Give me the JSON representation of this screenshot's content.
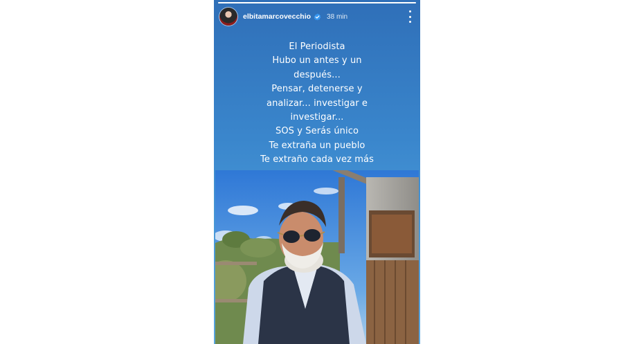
{
  "story": {
    "progress": 1.0,
    "username": "elbitamarcovecchio",
    "verified": true,
    "timestamp": "38 min",
    "caption_lines": [
      "El Periodista",
      "Hubo un antes y un",
      "después...",
      "Pensar, detenerse y",
      "analizar... investigar e",
      "investigar...",
      "SOS y Serás único",
      "Te extraña un pueblo",
      "Te extraño cada vez más"
    ],
    "icons": {
      "avatar": "profile-avatar",
      "verified": "verified-badge-icon",
      "menu": "more-vertical-icon"
    },
    "colors": {
      "background_top": "#2f6fb8",
      "background_bottom": "#5aa6de",
      "text": "#ffffff",
      "verified": "#3897f0"
    }
  }
}
